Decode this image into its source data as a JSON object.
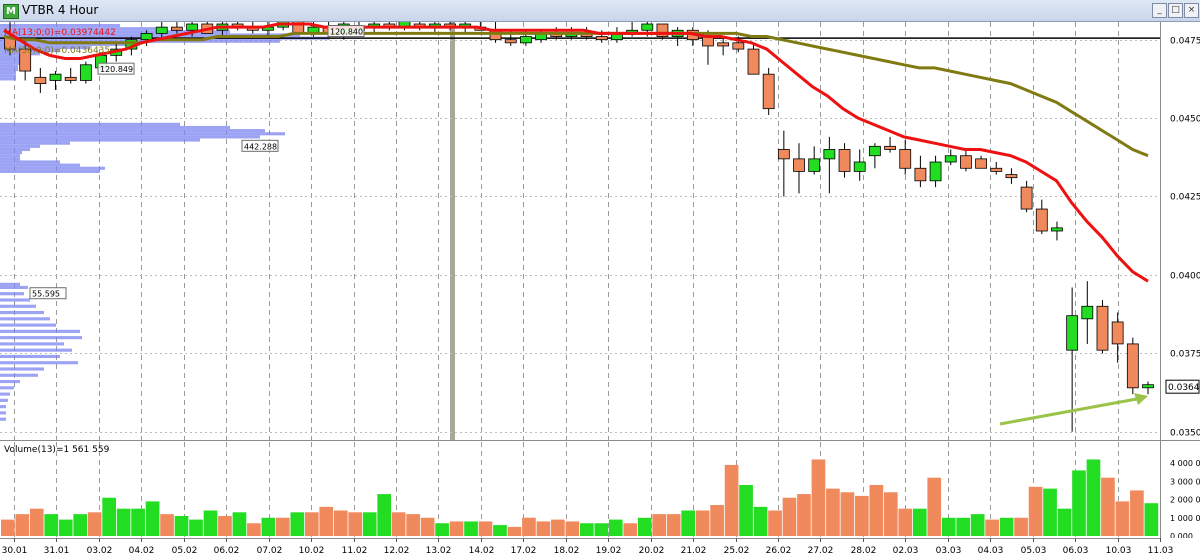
{
  "window": {
    "title": "VTBR 4 Hour",
    "icon": "chart-window-icon"
  },
  "colors": {
    "bull": "#22dd22",
    "bear": "#f08a5d",
    "ma13": "#ee1111",
    "ma50": "#7f7a12",
    "hline": "#000000",
    "arrow": "#9bc34a",
    "profile": "#7b84f0",
    "separator": "#a8a89a"
  },
  "chart_data": [
    {
      "type": "candlestick",
      "title": "VTBR 4 Hour",
      "indicators": [
        "MA(13;0;0)=0.03974442",
        "MA(50;0;0)=0.0436435"
      ],
      "y_ticks": [
        "0.047500",
        "0.045000",
        "0.042500",
        "0.040000",
        "0.037500",
        "0.035000"
      ],
      "ylim": [
        0.0348,
        0.048
      ],
      "current_price": "0.036420",
      "horizontal_line": 0.04755,
      "x_ticks": [
        "30.01",
        "31.01",
        "03.02",
        "04.02",
        "05.02",
        "06.02",
        "07.02",
        "10.02",
        "11.02",
        "12.02",
        "13.02",
        "14.02",
        "17.02",
        "18.02",
        "19.02",
        "20.02",
        "21.02",
        "25.02",
        "26.02",
        "27.02",
        "28.02",
        "02.03",
        "03.03",
        "04.03",
        "05.03",
        "06.03",
        "10.03",
        "11.03"
      ],
      "volume_profile_labels": [
        "120.849",
        "120.840",
        "442.288",
        "55.595"
      ],
      "candles": [
        {
          "o": 0.0476,
          "h": 0.0483,
          "l": 0.047,
          "c": 0.0472
        },
        {
          "o": 0.0472,
          "h": 0.0475,
          "l": 0.0462,
          "c": 0.0465
        },
        {
          "o": 0.0463,
          "h": 0.0466,
          "l": 0.0458,
          "c": 0.0461
        },
        {
          "o": 0.0462,
          "h": 0.0465,
          "l": 0.0459,
          "c": 0.0464
        },
        {
          "o": 0.0463,
          "h": 0.0466,
          "l": 0.0461,
          "c": 0.0462
        },
        {
          "o": 0.0462,
          "h": 0.0468,
          "l": 0.0461,
          "c": 0.0467
        },
        {
          "o": 0.0466,
          "h": 0.0471,
          "l": 0.0465,
          "c": 0.047
        },
        {
          "o": 0.047,
          "h": 0.0474,
          "l": 0.0468,
          "c": 0.0472
        },
        {
          "o": 0.0472,
          "h": 0.0476,
          "l": 0.047,
          "c": 0.0475
        },
        {
          "o": 0.0475,
          "h": 0.0478,
          "l": 0.0473,
          "c": 0.0477
        },
        {
          "o": 0.0477,
          "h": 0.0481,
          "l": 0.0475,
          "c": 0.0479
        },
        {
          "o": 0.0479,
          "h": 0.0483,
          "l": 0.0477,
          "c": 0.0478
        },
        {
          "o": 0.0478,
          "h": 0.0482,
          "l": 0.0476,
          "c": 0.048
        },
        {
          "o": 0.048,
          "h": 0.0484,
          "l": 0.0477,
          "c": 0.0477
        },
        {
          "o": 0.0478,
          "h": 0.0481,
          "l": 0.0476,
          "c": 0.048
        },
        {
          "o": 0.048,
          "h": 0.0483,
          "l": 0.0478,
          "c": 0.0479
        },
        {
          "o": 0.0479,
          "h": 0.0482,
          "l": 0.0477,
          "c": 0.0478
        },
        {
          "o": 0.0478,
          "h": 0.0482,
          "l": 0.0476,
          "c": 0.0479
        },
        {
          "o": 0.0479,
          "h": 0.0486,
          "l": 0.0478,
          "c": 0.0482
        },
        {
          "o": 0.0482,
          "h": 0.0486,
          "l": 0.0477,
          "c": 0.0477
        },
        {
          "o": 0.0477,
          "h": 0.0482,
          "l": 0.0476,
          "c": 0.0479
        },
        {
          "o": 0.0479,
          "h": 0.0481,
          "l": 0.0476,
          "c": 0.0477
        },
        {
          "o": 0.0477,
          "h": 0.0481,
          "l": 0.0475,
          "c": 0.048
        },
        {
          "o": 0.0478,
          "h": 0.0481,
          "l": 0.0476,
          "c": 0.0479
        },
        {
          "o": 0.0479,
          "h": 0.0484,
          "l": 0.0477,
          "c": 0.048
        },
        {
          "o": 0.048,
          "h": 0.0483,
          "l": 0.0478,
          "c": 0.0479
        },
        {
          "o": 0.0479,
          "h": 0.0482,
          "l": 0.0478,
          "c": 0.0481
        },
        {
          "o": 0.048,
          "h": 0.0482,
          "l": 0.0478,
          "c": 0.0479
        },
        {
          "o": 0.0479,
          "h": 0.0482,
          "l": 0.0477,
          "c": 0.048
        },
        {
          "o": 0.048,
          "h": 0.0482,
          "l": 0.0478,
          "c": 0.0479
        },
        {
          "o": 0.0479,
          "h": 0.0481,
          "l": 0.0477,
          "c": 0.048
        },
        {
          "o": 0.0479,
          "h": 0.0482,
          "l": 0.0478,
          "c": 0.0478
        },
        {
          "o": 0.0478,
          "h": 0.0481,
          "l": 0.0474,
          "c": 0.0475
        },
        {
          "o": 0.0475,
          "h": 0.0478,
          "l": 0.0473,
          "c": 0.0474
        },
        {
          "o": 0.0474,
          "h": 0.0478,
          "l": 0.0473,
          "c": 0.0476
        },
        {
          "o": 0.0475,
          "h": 0.0478,
          "l": 0.0474,
          "c": 0.0477
        },
        {
          "o": 0.0477,
          "h": 0.0479,
          "l": 0.0475,
          "c": 0.0476
        },
        {
          "o": 0.0476,
          "h": 0.0479,
          "l": 0.0475,
          "c": 0.0477
        },
        {
          "o": 0.0477,
          "h": 0.0479,
          "l": 0.0475,
          "c": 0.0476
        },
        {
          "o": 0.0476,
          "h": 0.0478,
          "l": 0.0474,
          "c": 0.0475
        },
        {
          "o": 0.0475,
          "h": 0.0479,
          "l": 0.0474,
          "c": 0.0477
        },
        {
          "o": 0.0477,
          "h": 0.0481,
          "l": 0.0476,
          "c": 0.0478
        },
        {
          "o": 0.0478,
          "h": 0.0482,
          "l": 0.0476,
          "c": 0.048
        },
        {
          "o": 0.048,
          "h": 0.048,
          "l": 0.0475,
          "c": 0.0476
        },
        {
          "o": 0.0476,
          "h": 0.0479,
          "l": 0.0473,
          "c": 0.0478
        },
        {
          "o": 0.0478,
          "h": 0.0479,
          "l": 0.0473,
          "c": 0.0475
        },
        {
          "o": 0.0476,
          "h": 0.0478,
          "l": 0.0467,
          "c": 0.0473
        },
        {
          "o": 0.0474,
          "h": 0.0476,
          "l": 0.047,
          "c": 0.0473
        },
        {
          "o": 0.0474,
          "h": 0.0476,
          "l": 0.0471,
          "c": 0.0472
        },
        {
          "o": 0.0472,
          "h": 0.0474,
          "l": 0.0467,
          "c": 0.0464
        },
        {
          "o": 0.0464,
          "h": 0.0466,
          "l": 0.0451,
          "c": 0.0453
        },
        {
          "o": 0.044,
          "h": 0.0446,
          "l": 0.0425,
          "c": 0.0437
        },
        {
          "o": 0.0437,
          "h": 0.0442,
          "l": 0.0426,
          "c": 0.0433
        },
        {
          "o": 0.0433,
          "h": 0.0441,
          "l": 0.0432,
          "c": 0.0437
        },
        {
          "o": 0.0437,
          "h": 0.0444,
          "l": 0.0426,
          "c": 0.044
        },
        {
          "o": 0.044,
          "h": 0.0442,
          "l": 0.0431,
          "c": 0.0433
        },
        {
          "o": 0.0433,
          "h": 0.044,
          "l": 0.043,
          "c": 0.0436
        },
        {
          "o": 0.0438,
          "h": 0.0442,
          "l": 0.0434,
          "c": 0.0441
        },
        {
          "o": 0.0441,
          "h": 0.0444,
          "l": 0.0439,
          "c": 0.044
        },
        {
          "o": 0.044,
          "h": 0.0443,
          "l": 0.0432,
          "c": 0.0434
        },
        {
          "o": 0.0434,
          "h": 0.0438,
          "l": 0.0428,
          "c": 0.043
        },
        {
          "o": 0.043,
          "h": 0.0438,
          "l": 0.0428,
          "c": 0.0436
        },
        {
          "o": 0.0436,
          "h": 0.044,
          "l": 0.0435,
          "c": 0.0438
        },
        {
          "o": 0.0438,
          "h": 0.044,
          "l": 0.0433,
          "c": 0.0434
        },
        {
          "o": 0.0437,
          "h": 0.0438,
          "l": 0.0434,
          "c": 0.0434
        },
        {
          "o": 0.0434,
          "h": 0.0436,
          "l": 0.0432,
          "c": 0.0433
        },
        {
          "o": 0.0432,
          "h": 0.0434,
          "l": 0.0429,
          "c": 0.0431
        },
        {
          "o": 0.0428,
          "h": 0.043,
          "l": 0.042,
          "c": 0.0421
        },
        {
          "o": 0.0421,
          "h": 0.0424,
          "l": 0.0413,
          "c": 0.0414
        },
        {
          "o": 0.0414,
          "h": 0.0417,
          "l": 0.0411,
          "c": 0.0415
        },
        {
          "o": 0.0376,
          "h": 0.0396,
          "l": 0.035,
          "c": 0.0387
        },
        {
          "o": 0.0386,
          "h": 0.0398,
          "l": 0.0378,
          "c": 0.039
        },
        {
          "o": 0.039,
          "h": 0.0392,
          "l": 0.0375,
          "c": 0.0376
        },
        {
          "o": 0.0385,
          "h": 0.0388,
          "l": 0.0372,
          "c": 0.0378
        },
        {
          "o": 0.0378,
          "h": 0.038,
          "l": 0.0362,
          "c": 0.0364
        },
        {
          "o": 0.0364,
          "h": 0.0366,
          "l": 0.0362,
          "c": 0.0365
        }
      ],
      "ma13": [
        0.0478,
        0.0475,
        0.0472,
        0.047,
        0.0469,
        0.0469,
        0.047,
        0.0471,
        0.0472,
        0.0474,
        0.0475,
        0.0476,
        0.0477,
        0.0478,
        0.0479,
        0.0479,
        0.0479,
        0.0479,
        0.048,
        0.048,
        0.048,
        0.0479,
        0.0479,
        0.0479,
        0.0479,
        0.0479,
        0.0479,
        0.0479,
        0.0479,
        0.0479,
        0.0479,
        0.0479,
        0.0478,
        0.0478,
        0.0478,
        0.0478,
        0.0478,
        0.0478,
        0.0478,
        0.0477,
        0.0477,
        0.0477,
        0.0477,
        0.0477,
        0.0477,
        0.0477,
        0.0476,
        0.0476,
        0.0475,
        0.0474,
        0.0472,
        0.0468,
        0.0464,
        0.046,
        0.0457,
        0.0453,
        0.045,
        0.0448,
        0.0446,
        0.0444,
        0.0443,
        0.0442,
        0.0441,
        0.044,
        0.044,
        0.0439,
        0.0438,
        0.0436,
        0.0433,
        0.043,
        0.0423,
        0.0417,
        0.0412,
        0.0406,
        0.0401,
        0.0398
      ],
      "ma50": [
        0.0476,
        0.0475,
        0.0475,
        0.0474,
        0.0474,
        0.0474,
        0.0474,
        0.0474,
        0.0474,
        0.0474,
        0.0475,
        0.0475,
        0.0475,
        0.0475,
        0.0476,
        0.0476,
        0.0476,
        0.0476,
        0.0476,
        0.0477,
        0.0477,
        0.0477,
        0.0477,
        0.0477,
        0.0477,
        0.0477,
        0.0477,
        0.0477,
        0.0477,
        0.0477,
        0.0477,
        0.0477,
        0.0477,
        0.0477,
        0.0477,
        0.0477,
        0.0477,
        0.0477,
        0.0477,
        0.0477,
        0.0477,
        0.0477,
        0.0477,
        0.0477,
        0.0477,
        0.0477,
        0.0477,
        0.0477,
        0.0477,
        0.0476,
        0.0476,
        0.0475,
        0.0474,
        0.0473,
        0.0472,
        0.0471,
        0.047,
        0.0469,
        0.0468,
        0.0467,
        0.0466,
        0.0466,
        0.0465,
        0.0464,
        0.0463,
        0.0462,
        0.0461,
        0.0459,
        0.0457,
        0.0455,
        0.0452,
        0.0449,
        0.0446,
        0.0443,
        0.044,
        0.0438
      ]
    },
    {
      "type": "bar",
      "title": "Volume(13)=1 561 559",
      "y_ticks": [
        "4 000 000",
        "3 000 000",
        "2 000 000",
        "1 000 000",
        "0.000"
      ],
      "ylim": [
        0,
        4500000
      ],
      "values": [
        900000,
        1200000,
        1500000,
        1200000,
        900000,
        1200000,
        1300000,
        2100000,
        1500000,
        1500000,
        1900000,
        1200000,
        1100000,
        900000,
        1400000,
        1100000,
        1300000,
        700000,
        1000000,
        1000000,
        1300000,
        1300000,
        1600000,
        1400000,
        1300000,
        1300000,
        2300000,
        1300000,
        1200000,
        1000000,
        700000,
        800000,
        800000,
        800000,
        600000,
        500000,
        1000000,
        800000,
        900000,
        800000,
        700000,
        700000,
        900000,
        700000,
        1000000,
        1200000,
        1200000,
        1400000,
        1400000,
        1700000,
        3900000,
        2800000,
        1600000,
        1400000,
        2100000,
        2300000,
        4200000,
        2600000,
        2400000,
        2200000,
        2800000,
        2400000,
        1500000,
        1500000,
        3200000,
        1000000,
        1000000,
        1200000,
        900000,
        1000000,
        1000000,
        2700000,
        2600000,
        1500000,
        3600000,
        4200000,
        3200000,
        1900000,
        2500000,
        1800000
      ],
      "bar_colors": [
        "bear",
        "bear",
        "bear",
        "bull",
        "bull",
        "bull",
        "bear",
        "bull",
        "bull",
        "bull",
        "bull",
        "bear",
        "bull",
        "bull",
        "bull",
        "bear",
        "bull",
        "bear",
        "bull",
        "bear",
        "bull",
        "bear",
        "bear",
        "bear",
        "bear",
        "bull",
        "bull",
        "bear",
        "bear",
        "bear",
        "bull",
        "bear",
        "bull",
        "bear",
        "bull",
        "bear",
        "bear",
        "bear",
        "bear",
        "bear",
        "bull",
        "bull",
        "bull",
        "bear",
        "bull",
        "bear",
        "bear",
        "bull",
        "bear",
        "bear",
        "bear",
        "bull",
        "bull",
        "bear",
        "bear",
        "bear",
        "bear",
        "bear",
        "bear",
        "bear",
        "bear",
        "bear",
        "bear",
        "bull",
        "bear",
        "bull",
        "bull",
        "bull",
        "bear",
        "bull",
        "bear",
        "bear",
        "bull",
        "bull",
        "bull",
        "bull",
        "bear",
        "bear",
        "bear",
        "bull"
      ]
    }
  ]
}
